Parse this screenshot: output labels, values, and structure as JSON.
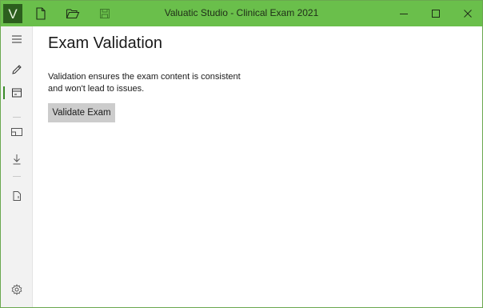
{
  "window": {
    "title": "Valuatic Studio - Clinical Exam 2021",
    "logo_letter": "V",
    "accent_color": "#6abf4b",
    "logo_color": "#2c5e1e"
  },
  "toolbar": {
    "icons": [
      "new-file-icon",
      "open-folder-icon",
      "save-icon"
    ]
  },
  "window_controls": {
    "minimize": "—",
    "maximize": "☐",
    "close": "✕"
  },
  "sidebar": {
    "items": [
      {
        "icon": "hamburger-menu-icon",
        "selected": false
      },
      {
        "icon": "pencil-icon",
        "selected": false
      },
      {
        "icon": "validate-icon",
        "selected": true
      },
      {
        "icon": "preview-icon",
        "selected": false
      },
      {
        "icon": "download-icon",
        "selected": false
      },
      {
        "icon": "export-icon",
        "selected": false
      },
      {
        "icon": "settings-icon",
        "selected": false
      }
    ]
  },
  "main": {
    "title": "Exam Validation",
    "description_line1": "Validation ensures the exam content is consistent",
    "description_line2": "and won't lead to issues.",
    "validate_button_label": "Validate Exam"
  }
}
